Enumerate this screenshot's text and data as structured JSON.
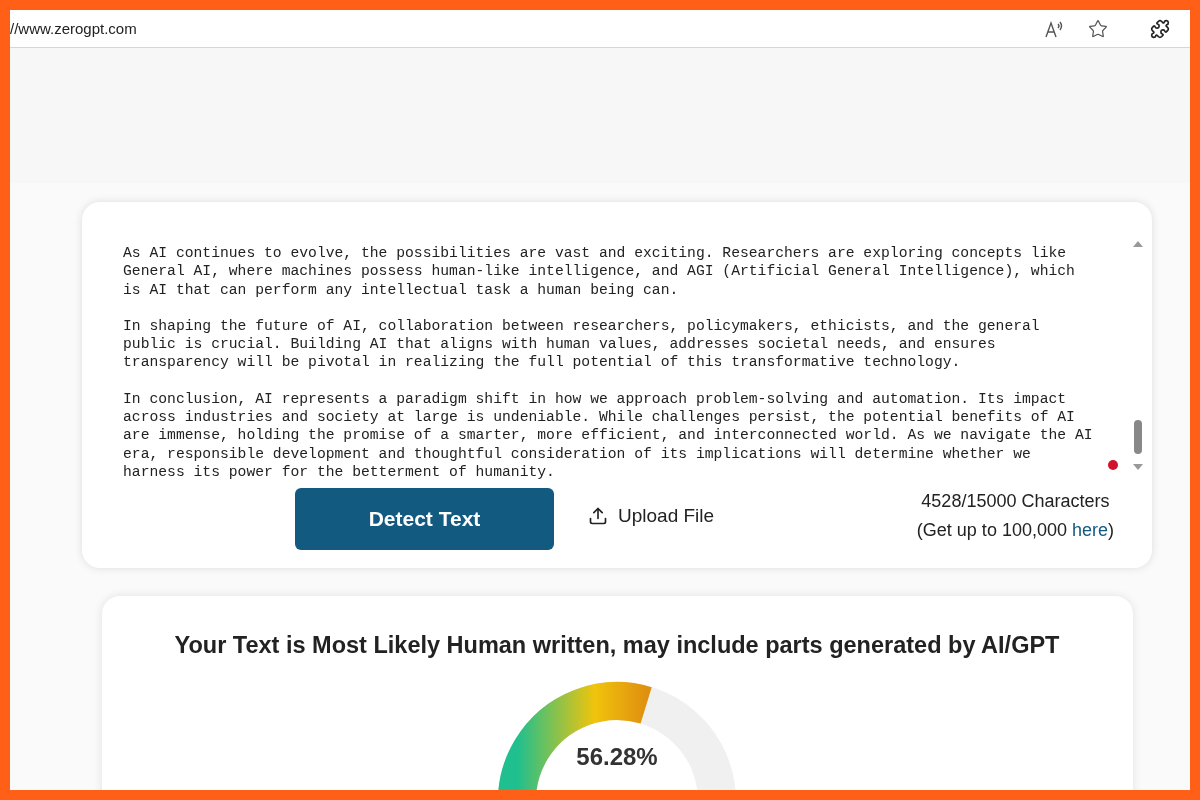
{
  "browser": {
    "address": "//www.zerogpt.com"
  },
  "editor": {
    "paragraphs": [
      "As AI continues to evolve, the possibilities are vast and exciting. Researchers are exploring concepts like\nGeneral AI, where machines possess human-like intelligence, and AGI (Artificial General Intelligence), which\nis AI that can perform any intellectual task a human being can.",
      "In shaping the future of AI, collaboration between researchers, policymakers, ethicists, and the general\npublic is crucial. Building AI that aligns with human values, addresses societal needs, and ensures\ntransparency will be pivotal in realizing the full potential of this transformative technology.",
      "In conclusion, AI represents a paradigm shift in how we approach problem-solving and automation. Its impact\nacross industries and society at large is undeniable. While challenges persist, the potential benefits of AI\nare immense, holding the promise of a smarter, more efficient, and interconnected world. As we navigate the AI\nera, responsible development and thoughtful consideration of its implications will determine whether we\nharness its power for the betterment of humanity."
    ],
    "detect_button": "Detect Text",
    "upload_button": "Upload File",
    "character_count": "4528/15000 Characters",
    "upgrade_text": "(Get up to 100,000",
    "upgrade_link": "here",
    "upgrade_close": ")"
  },
  "result": {
    "title": "Your Text is Most Likely Human written, may include parts generated by AI/GPT",
    "gauge": {
      "reading": "56.28%"
    }
  }
}
